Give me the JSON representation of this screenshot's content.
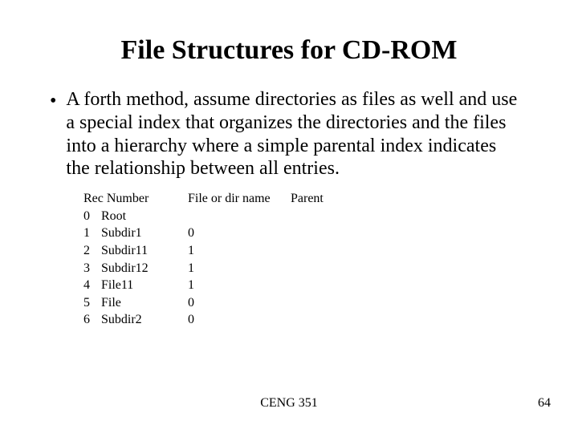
{
  "title": "File Structures for CD-ROM",
  "bullet": {
    "marker": "•",
    "text": "A forth method, assume directories as files as well and use a special index that organizes the directories and the files into a hierarchy where a simple parental index indicates the relationship between all entries."
  },
  "table": {
    "headers": {
      "rec": "Rec Number",
      "file": "File or dir name",
      "parent": "Parent"
    },
    "rows": [
      {
        "rec": "0",
        "name": "Root",
        "parent": ""
      },
      {
        "rec": "1",
        "name": "Subdir1",
        "parent": "0"
      },
      {
        "rec": "2",
        "name": "Subdir11",
        "parent": "1"
      },
      {
        "rec": "3",
        "name": "Subdir12",
        "parent": "1"
      },
      {
        "rec": "4",
        "name": "File11",
        "parent": "1"
      },
      {
        "rec": "5",
        "name": "File",
        "parent": "0"
      },
      {
        "rec": "6",
        "name": "Subdir2",
        "parent": "0"
      }
    ]
  },
  "footer": {
    "course": "CENG 351",
    "page": "64"
  }
}
